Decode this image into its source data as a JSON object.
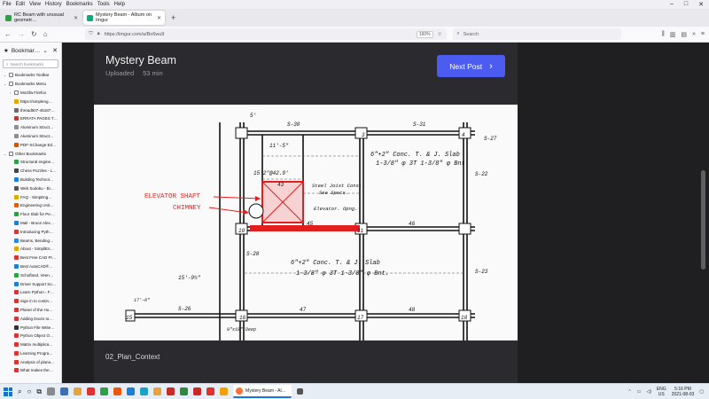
{
  "menubar": {
    "items": [
      "File",
      "Edit",
      "View",
      "History",
      "Bookmarks",
      "Tools",
      "Help"
    ]
  },
  "window_controls": {
    "minimize": "–",
    "maximize": "□",
    "close": "✕"
  },
  "tabs": [
    {
      "label": "RC Beam with unusual geometr…",
      "active": false,
      "color": "#2f9e44"
    },
    {
      "label": "Mystery Beam - Album on Imgur",
      "active": true,
      "color": "#1aa37a"
    }
  ],
  "nav": {
    "url": "https://imgur.com/a/Bo6wu9",
    "zoom": "160%",
    "search_placeholder": "Search"
  },
  "sidebar": {
    "title": "Bookmar…",
    "search_placeholder": "Search bookmarks",
    "items": [
      {
        "label": "Bookmarks Toolbar",
        "type": "folder",
        "indent": 0,
        "color": "#777777"
      },
      {
        "label": "Bookmarks Menu",
        "type": "folder",
        "indent": 0,
        "color": "#777777"
      },
      {
        "label": "Mozilla Firefox",
        "type": "folder",
        "indent": 1,
        "color": "#777777"
      },
      {
        "label": "https://simpleng…",
        "type": "link",
        "indent": 1,
        "color": "#e0a800"
      },
      {
        "label": "thread507-45187…",
        "type": "link",
        "indent": 1,
        "color": "#6c6c6c"
      },
      {
        "label": "ERRATA PAGES T…",
        "type": "link",
        "indent": 1,
        "color": "#c0392b"
      },
      {
        "label": "Aluminum Struct…",
        "type": "link",
        "indent": 1,
        "color": "#8e8e8e"
      },
      {
        "label": "Aluminum Struct…",
        "type": "link",
        "indent": 1,
        "color": "#8e8e8e"
      },
      {
        "label": "PDF-XChange Ed…",
        "type": "link",
        "indent": 1,
        "color": "#d35400"
      },
      {
        "label": "Other Bookmarks",
        "type": "folder",
        "indent": 0,
        "color": "#777777"
      },
      {
        "label": "Structural engine…",
        "type": "link",
        "indent": 1,
        "color": "#2f9e44"
      },
      {
        "label": "Chess Puzzles - L…",
        "type": "link",
        "indent": 1,
        "color": "#444444"
      },
      {
        "label": "Building Technol…",
        "type": "link",
        "indent": 1,
        "color": "#1c7ed6"
      },
      {
        "label": "Web Sudoku - Bi…",
        "type": "link",
        "indent": 1,
        "color": "#555555"
      },
      {
        "label": "FAQ - SimpEng…",
        "type": "link",
        "indent": 1,
        "color": "#e0a800"
      },
      {
        "label": "Engineering Unit…",
        "type": "link",
        "indent": 1,
        "color": "#e8590c"
      },
      {
        "label": "Floor Slab for Pe…",
        "type": "link",
        "indent": 1,
        "color": "#2f9e44"
      },
      {
        "label": "Mail - Bruce Alex…",
        "type": "link",
        "indent": 1,
        "color": "#1c7ed6"
      },
      {
        "label": "Introducing Pyth…",
        "type": "link",
        "indent": 1,
        "color": "#e03131"
      },
      {
        "label": "Beams, Bending…",
        "type": "link",
        "indent": 1,
        "color": "#228be6"
      },
      {
        "label": "About - SimpliEn…",
        "type": "link",
        "indent": 1,
        "color": "#e0a800"
      },
      {
        "label": "Best Free CAD Pr…",
        "type": "link",
        "indent": 1,
        "color": "#e03131"
      },
      {
        "label": "Best AutoCAD®…",
        "type": "link",
        "indent": 1,
        "color": "#1c7ed6"
      },
      {
        "label": "Schofland, Veen…",
        "type": "link",
        "indent": 1,
        "color": "#2f9e44"
      },
      {
        "label": "Driver Support So…",
        "type": "link",
        "indent": 1,
        "color": "#1c7ed6"
      },
      {
        "label": "Learn Python - F…",
        "type": "link",
        "indent": 1,
        "color": "#e03131"
      },
      {
        "label": "Sign in to contin…",
        "type": "link",
        "indent": 1,
        "color": "#e03131"
      },
      {
        "label": "Planet of the Hu…",
        "type": "link",
        "indent": 1,
        "color": "#e03131"
      },
      {
        "label": "Adding Doors to…",
        "type": "link",
        "indent": 1,
        "color": "#e03131"
      },
      {
        "label": "Python File Write…",
        "type": "link",
        "indent": 1,
        "color": "#333333"
      },
      {
        "label": "Python Object O…",
        "type": "link",
        "indent": 1,
        "color": "#e03131"
      },
      {
        "label": "Matrix multiplica…",
        "type": "link",
        "indent": 1,
        "color": "#e03131"
      },
      {
        "label": "Learning Progra…",
        "type": "link",
        "indent": 1,
        "color": "#e03131"
      },
      {
        "label": "Analysis of plana…",
        "type": "link",
        "indent": 1,
        "color": "#e03131"
      },
      {
        "label": "What makes the…",
        "type": "link",
        "indent": 1,
        "color": "#e03131"
      }
    ]
  },
  "post": {
    "title": "Mystery Beam",
    "uploaded_label": "Uploaded",
    "time": "53 min",
    "next_label": "Next Post",
    "caption": "02_Plan_Context"
  },
  "drawing": {
    "annotation_elevator": "ELEVATOR SHAFT",
    "annotation_chimney": "CHIMNEY",
    "slab_note_1": "6\"+2\" Conc. T. & J. Slab",
    "slab_note_1b": "1-3/8\" φ 3T  1-3/8\" φ Bnt.",
    "slab_note_2": "6\"+2\" Conc. T. & J. Slab",
    "slab_note_2b": "1-3/8\" φ 3T  1-3/8\" φ Bnt.",
    "steel_joist": "Steel Joist Const.",
    "see_specs": "See Specs.",
    "elevator_opng": "Elevator. Opng.",
    "dim_11_5": "11'-5\"",
    "dim_15_2": "15'2\"@42.9'",
    "dim_15_9": "15'-9½\"",
    "dim_17_6": "17'-6\"",
    "col_labels": [
      "2",
      "3",
      "4",
      "10",
      "11",
      "16",
      "17",
      "18",
      "15"
    ],
    "beam_labels": [
      "S-30",
      "S-31",
      "45",
      "46",
      "47",
      "48",
      "43",
      "S-28",
      "S-22",
      "S-23",
      "S-26"
    ],
    "misc": [
      "9\"x10\" Deep",
      "S-27",
      "5'"
    ]
  },
  "taskbar": {
    "active_label": "Mystery Beam - Al…",
    "lang": "ENG",
    "region": "US",
    "time": "5:16 PM",
    "date": "2021-08-03"
  },
  "colors": {
    "accent_button": "#4c5cf0",
    "highlight_beam": "#e41e1e",
    "annotation": "#e41e1e"
  }
}
